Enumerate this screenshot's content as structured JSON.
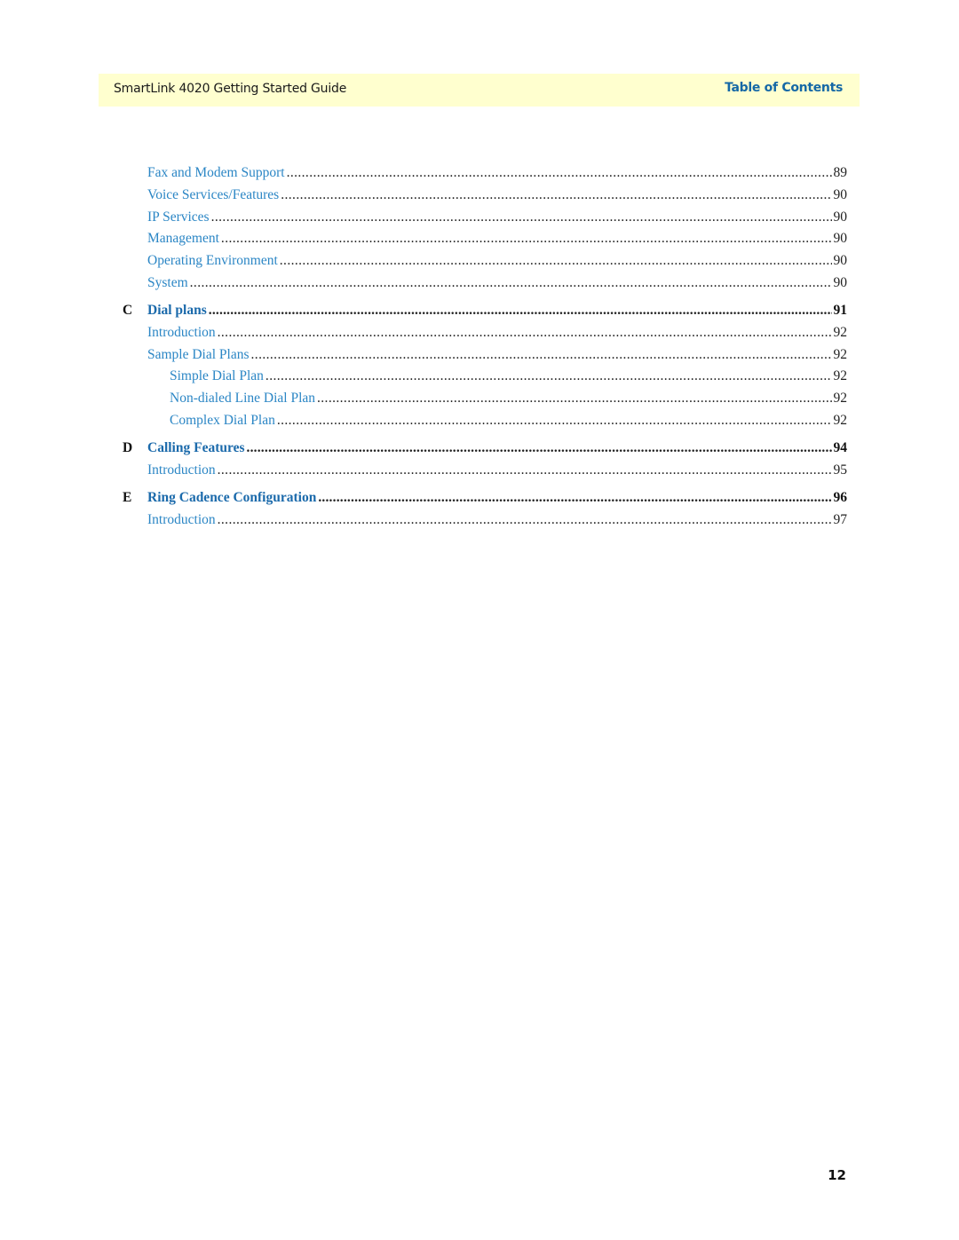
{
  "header": {
    "title": "SmartLink 4020 Getting Started Guide",
    "section": "Table of Contents",
    "background_color": "#ffffcf",
    "section_color": "#1568a6"
  },
  "toc": {
    "entries": [
      {
        "level": 1,
        "letter": "",
        "label": "Fax and Modem Support",
        "page": "89"
      },
      {
        "level": 1,
        "letter": "",
        "label": "Voice Services/Features",
        "page": "90"
      },
      {
        "level": 1,
        "letter": "",
        "label": "IP Services",
        "page": "90"
      },
      {
        "level": 1,
        "letter": "",
        "label": "Management",
        "page": "90"
      },
      {
        "level": 1,
        "letter": "",
        "label": "Operating Environment",
        "page": "90"
      },
      {
        "level": 1,
        "letter": "",
        "label": "System",
        "page": "90"
      },
      {
        "level": 0,
        "letter": "C",
        "label": "Dial plans",
        "page": "91"
      },
      {
        "level": 1,
        "letter": "",
        "label": "Introduction",
        "page": "92"
      },
      {
        "level": 1,
        "letter": "",
        "label": "Sample Dial Plans",
        "page": "92"
      },
      {
        "level": 2,
        "letter": "",
        "label": "Simple Dial Plan",
        "page": "92"
      },
      {
        "level": 2,
        "letter": "",
        "label": "Non-dialed Line Dial Plan",
        "page": "92"
      },
      {
        "level": 2,
        "letter": "",
        "label": "Complex Dial Plan",
        "page": "92"
      },
      {
        "level": 0,
        "letter": "D",
        "label": "Calling Features",
        "page": "94"
      },
      {
        "level": 1,
        "letter": "",
        "label": "Introduction",
        "page": "95"
      },
      {
        "level": 0,
        "letter": "E",
        "label": "Ring Cadence Configuration",
        "page": "96"
      },
      {
        "level": 1,
        "letter": "",
        "label": "Introduction",
        "page": "97"
      }
    ],
    "link_color": "#2b86c5",
    "chapter_color": "#1b6aab"
  },
  "footer": {
    "page_number": "12"
  }
}
